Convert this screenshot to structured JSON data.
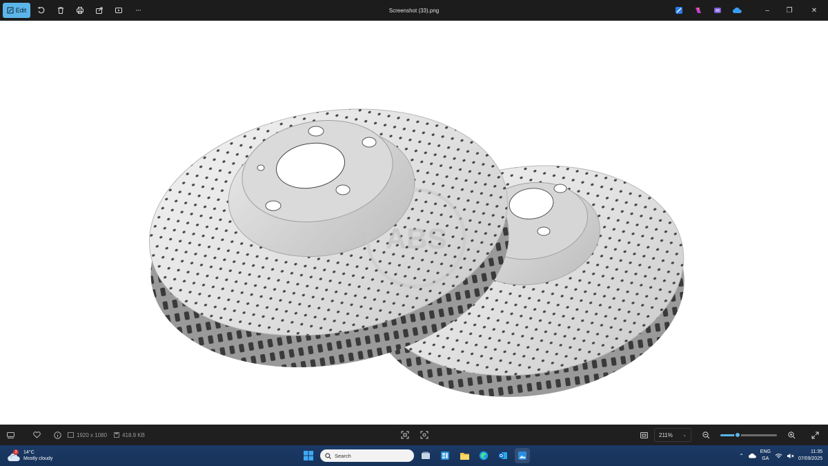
{
  "window": {
    "title": "Screenshot (33).png",
    "edit_label": "Edit",
    "controls": {
      "minimize": "–",
      "restore": "❐",
      "close": "✕"
    }
  },
  "toolbar": {
    "icons": [
      "rotate-icon",
      "delete-icon",
      "print-icon",
      "share-icon",
      "slideshow-icon",
      "more-icon"
    ],
    "more_label": "···"
  },
  "viewer": {
    "image_subject": "two drilled brake discs",
    "watermark": "ABS",
    "background": "#ffffff"
  },
  "statusbar": {
    "dimensions": "1920 x 1080",
    "file_size": "418.9 KB",
    "zoom": "211%",
    "zoom_level_fraction": 0.3
  },
  "taskbar": {
    "weather": {
      "temp": "14°C",
      "condition": "Mostly cloudy",
      "badge": "3"
    },
    "search_placeholder": "Search",
    "language": "ENG",
    "layout": "GA",
    "time": "11:35",
    "date": "07/09/2025"
  },
  "colors": {
    "accent": "#5bb5e8",
    "titlebar": "#1c1c1c",
    "statusbar": "#1f1f1f",
    "taskbar": "#1b3a66"
  }
}
